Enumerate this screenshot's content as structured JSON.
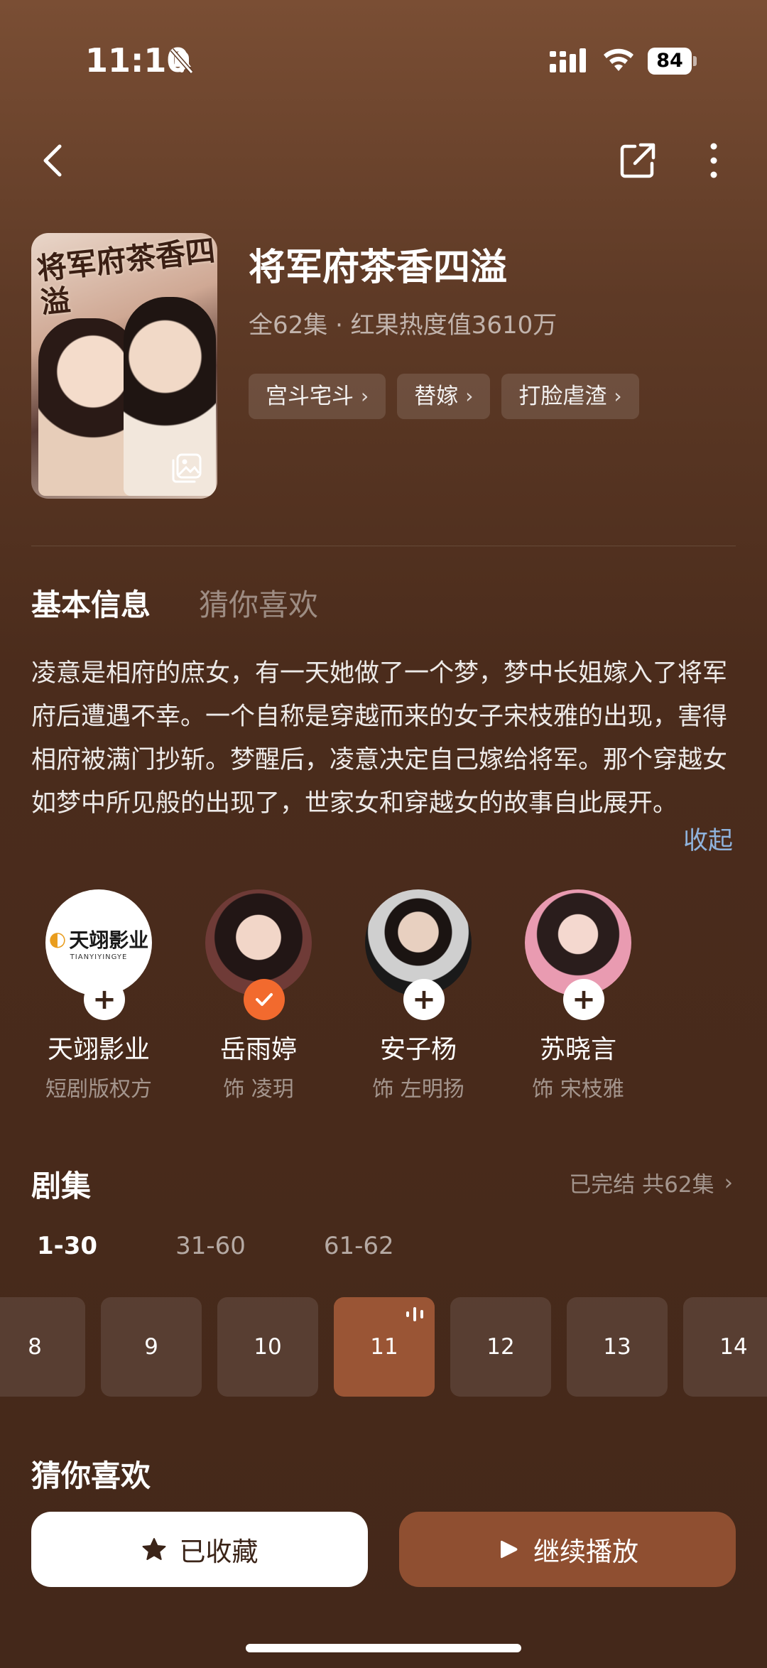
{
  "status_bar": {
    "time": "11:10",
    "battery": "84"
  },
  "show": {
    "poster_title": "将军府茶香四溢",
    "title": "将军府茶香四溢",
    "meta": "全62集 · 红果热度值3610万",
    "tags": [
      {
        "label": "宫斗宅斗"
      },
      {
        "label": "替嫁"
      },
      {
        "label": "打脸虐渣"
      }
    ]
  },
  "section_tabs": {
    "active": "基本信息",
    "inactive": "猜你喜欢"
  },
  "description": {
    "text": "凌意是相府的庶女，有一天她做了一个梦，梦中长姐嫁入了将军府后遭遇不幸。一个自称是穿越而来的女子宋枝雅的出现，害得相府被满门抄斩。梦醒后，凌意决定自己嫁给将军。那个穿越女如梦中所见般的出现了，世家女和穿越女的故事自此展开。",
    "collapse_label": "收起"
  },
  "cast": [
    {
      "name": "天翊影业",
      "role": "短剧版权方",
      "logo_text": "天翊影业",
      "logo_sub": "TIANYIYINGYE",
      "followed": false
    },
    {
      "name": "岳雨婷",
      "role": "饰 凌玥",
      "followed": true
    },
    {
      "name": "安子杨",
      "role": "饰 左明扬",
      "followed": false
    },
    {
      "name": "苏晓言",
      "role": "饰 宋枝雅",
      "followed": false
    }
  ],
  "episodes": {
    "title": "剧集",
    "status": "已完结 共62集",
    "ranges": [
      "1-30",
      "31-60",
      "61-62"
    ],
    "active_range": "1-30",
    "visible": [
      "8",
      "9",
      "10",
      "11",
      "12",
      "13",
      "14"
    ],
    "current": "11"
  },
  "recommend_title": "猜你喜欢",
  "buttons": {
    "favorite": "已收藏",
    "play": "继续播放"
  },
  "colors": {
    "accent_orange": "#f26a2e",
    "current_episode": "#9a5535",
    "play_button": "#8f4f31",
    "link_blue": "#8fb3dd"
  }
}
